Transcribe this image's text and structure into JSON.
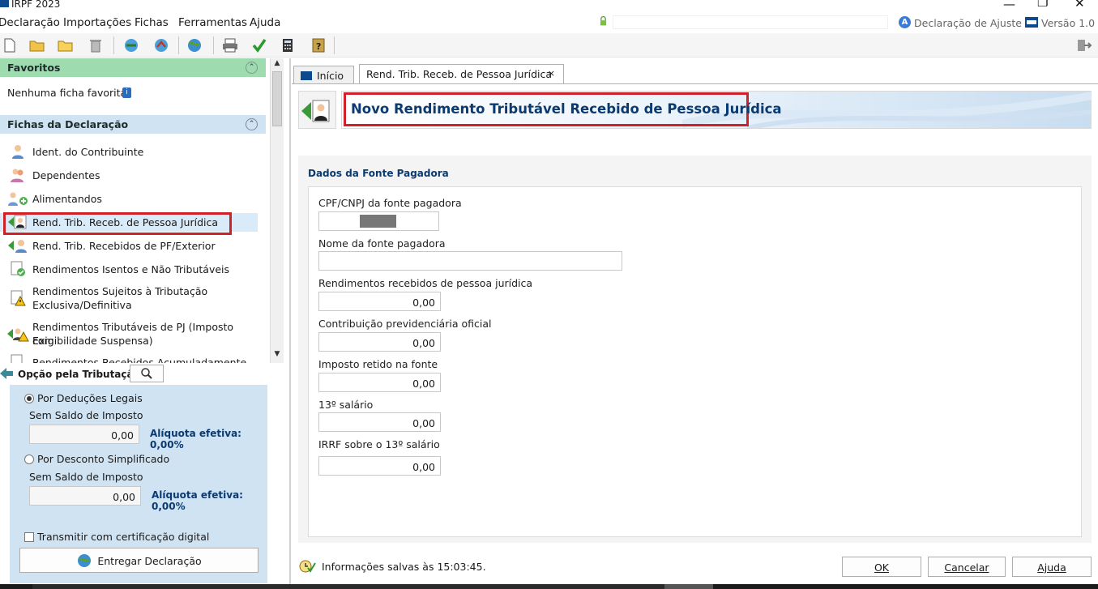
{
  "window": {
    "title": "IRPF 2023"
  },
  "menu": {
    "items": [
      "Declaração",
      "Importações",
      "Fichas",
      "Ferramentas",
      "Ajuda"
    ],
    "declaration_type": "Declaração de Ajuste",
    "version": "Versão 1.0"
  },
  "toolbar": {
    "icons": [
      "new-icon",
      "open-icon",
      "folder-icon",
      "trash-icon",
      "import-icon",
      "recovery-icon",
      "globe-icon",
      "print-icon",
      "check-icon",
      "calculator-icon",
      "help-icon",
      "exit-icon"
    ]
  },
  "favorites": {
    "title": "Favoritos",
    "empty_text": "Nenhuma ficha favorita"
  },
  "fichas": {
    "title": "Fichas da Declaração",
    "items": [
      {
        "label": "Ident. do Contribuinte"
      },
      {
        "label": "Dependentes"
      },
      {
        "label": "Alimentandos"
      },
      {
        "label": "Rend. Trib. Receb. de Pessoa Jurídica"
      },
      {
        "label": "Rend. Trib. Recebidos de PF/Exterior"
      },
      {
        "label": "Rendimentos Isentos e Não Tributáveis"
      },
      {
        "label": "Rendimentos Sujeitos à Tributação",
        "label2": "Exclusiva/Definitiva"
      },
      {
        "label": "Rendimentos Tributáveis de PJ (Imposto com",
        "label2": "Exigibilidade Suspensa)"
      },
      {
        "label": "Rendimentos Recebidos Acumuladamente"
      }
    ]
  },
  "tributacao": {
    "title": "Opção pela Tributação:",
    "deducoes_label": "Por Deduções Legais",
    "deducoes_saldo_label": "Sem Saldo de Imposto",
    "deducoes_value": "0,00",
    "deducoes_aliquota": "Alíquota efetiva: 0,00%",
    "simplificado_label": "Por Desconto Simplificado",
    "simplificado_saldo_label": "Sem Saldo de Imposto",
    "simplificado_value": "0,00",
    "simplificado_aliquota": "Alíquota efetiva: 0,00%",
    "certificado_label": "Transmitir com certificação digital",
    "entregar_label": "Entregar Declaração"
  },
  "tabs": [
    {
      "label": "Início"
    },
    {
      "label": "Rend. Trib. Receb. de Pessoa Jurídica",
      "close": "×"
    }
  ],
  "form": {
    "title": "Novo Rendimento Tributável Recebido de Pessoa Jurídica",
    "section_title": "Dados da Fonte Pagadora",
    "cpf_label": "CPF/CNPJ da fonte pagadora",
    "nome_label": "Nome da fonte pagadora",
    "nome_value": "",
    "rendimentos_label": "Rendimentos recebidos de pessoa jurídica",
    "rendimentos_value": "0,00",
    "contribuicao_label": "Contribuição previdenciária oficial",
    "contribuicao_value": "0,00",
    "imposto_label": "Imposto retido na fonte",
    "imposto_value": "0,00",
    "decimo_label": "13º salário",
    "decimo_value": "0,00",
    "irrf_label": "IRRF sobre o 13º salário",
    "irrf_value": "0,00"
  },
  "status": {
    "saved_text": "Informações salvas às 15:03:45."
  },
  "buttons": {
    "ok": "OK",
    "cancel": "Cancelar",
    "help": "Ajuda"
  },
  "colors": {
    "accent_red": "#d0202a",
    "favorites_green": "#9edcb0",
    "panel_blue": "#cfe3f3",
    "title_blue": "#0b3a70"
  }
}
